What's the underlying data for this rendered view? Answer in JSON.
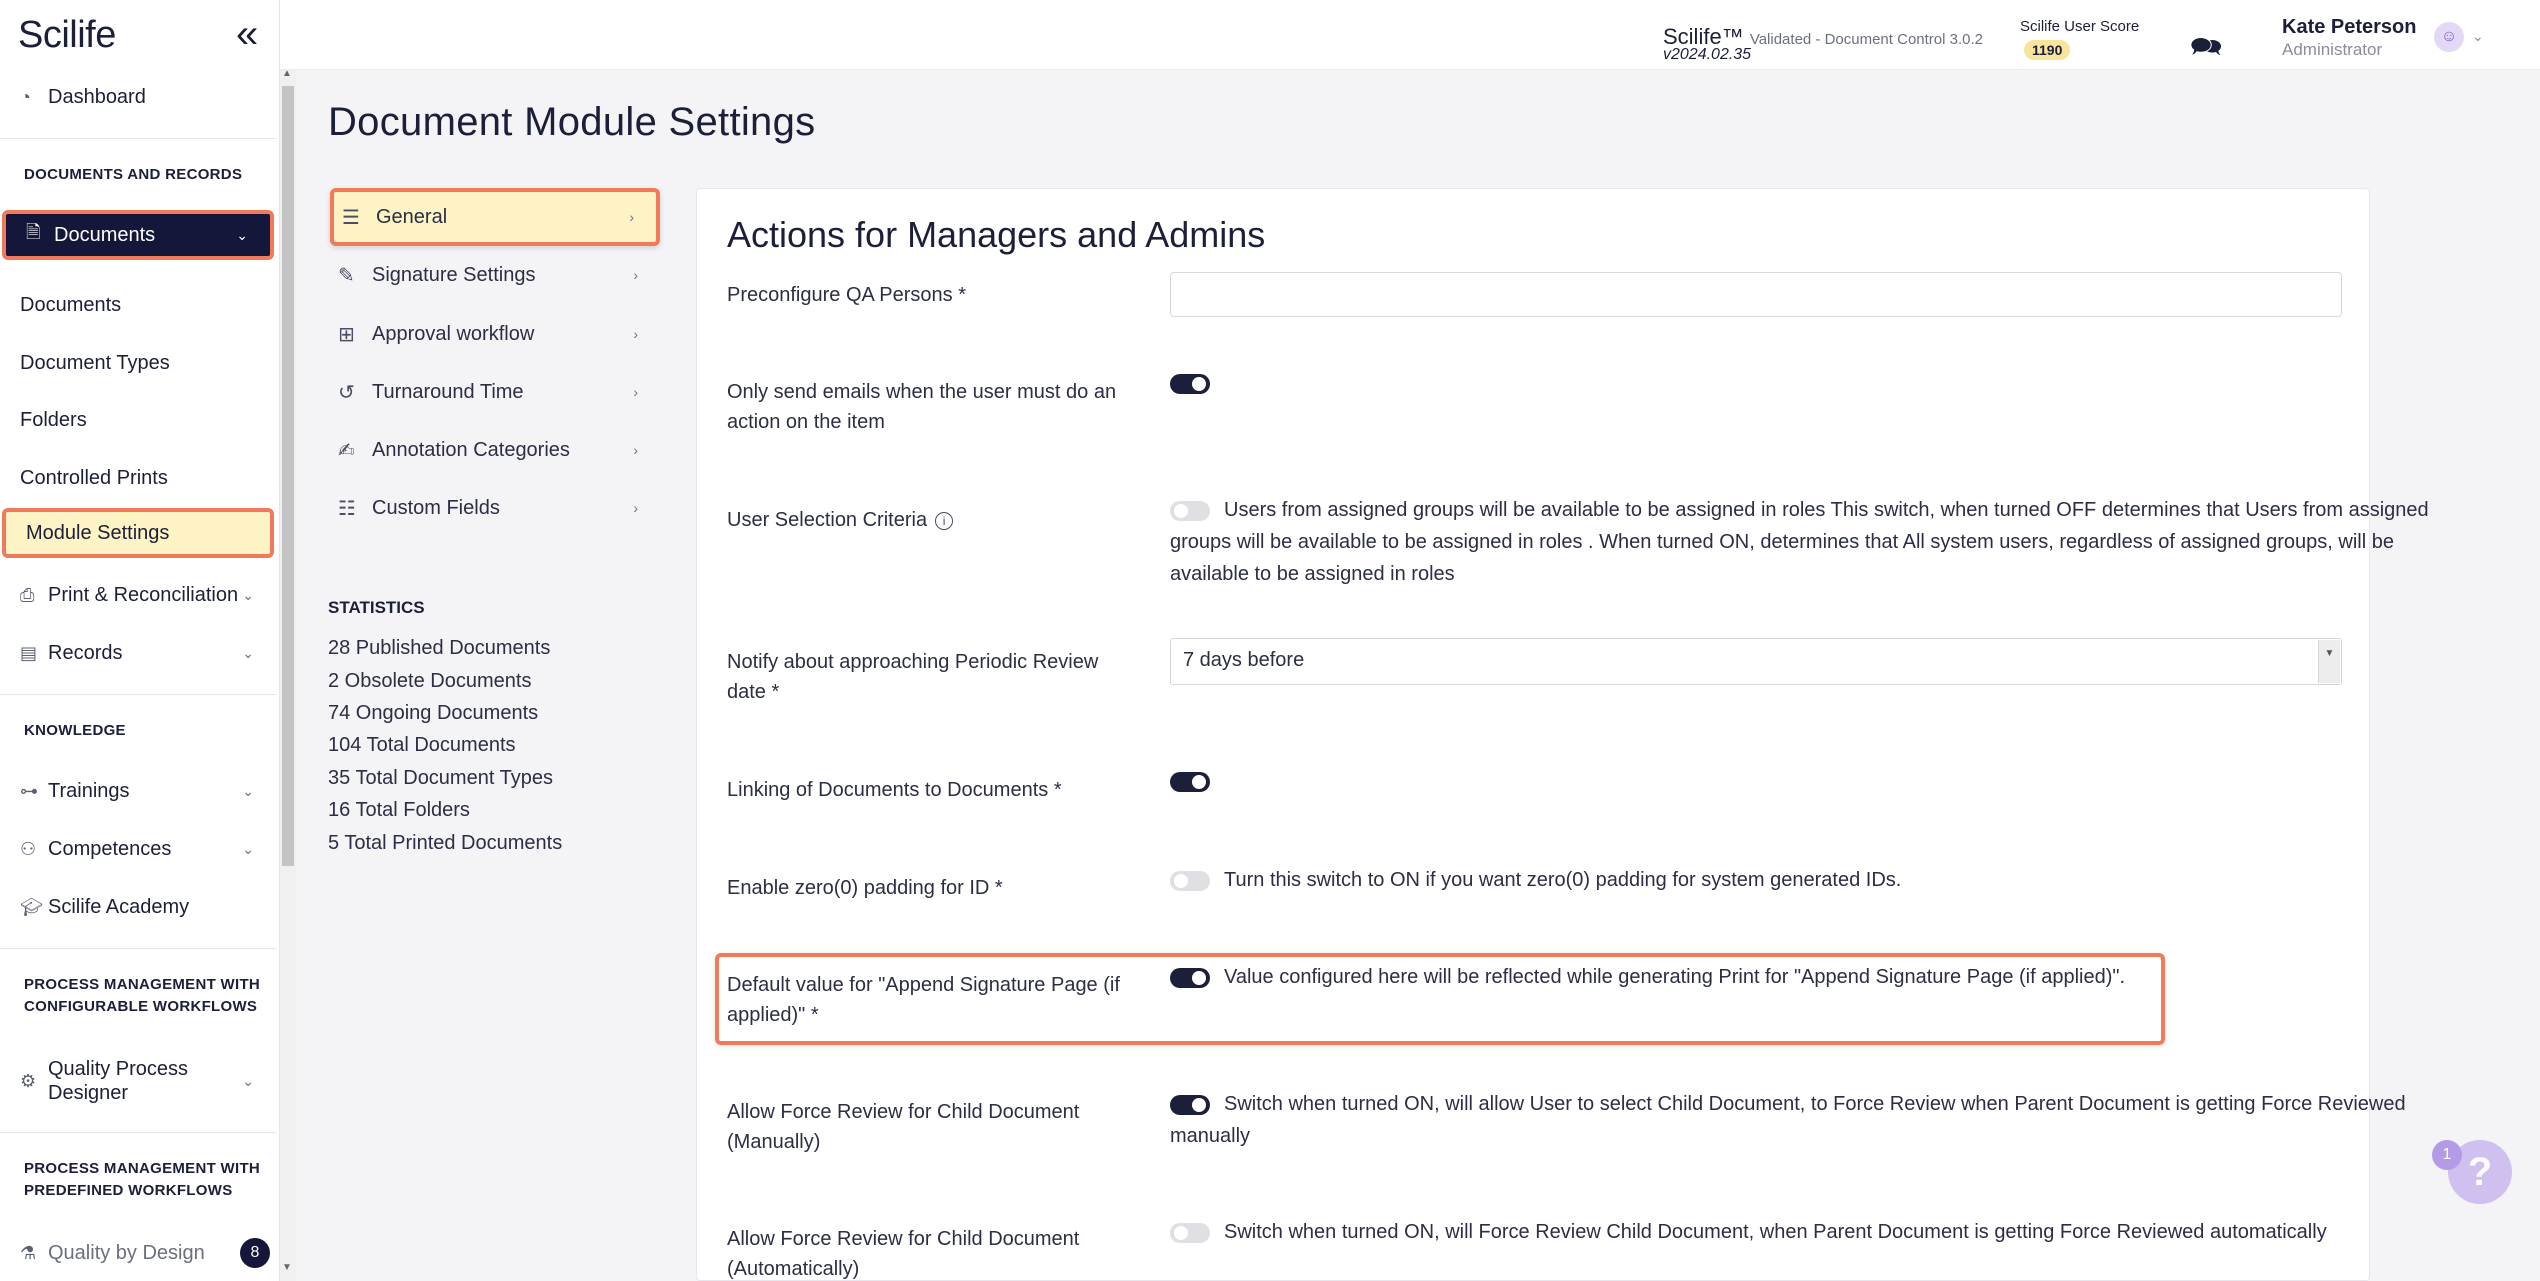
{
  "app": {
    "logo": "Scilife",
    "collapse_icon": "double-chevron-left-icon"
  },
  "topbar": {
    "product": "Scilife™",
    "product_sub": "Validated - Document Control 3.0.2",
    "version": "v2024.02.35",
    "score_label": "Scilife User Score",
    "score_value": "1190",
    "user_name": "Kate Peterson",
    "user_role": "Administrator"
  },
  "sidebar": {
    "dashboard": "Dashboard",
    "section_docs": "DOCUMENTS AND RECORDS",
    "documents_group": "Documents",
    "sub_documents": "Documents",
    "sub_document_types": "Document Types",
    "sub_folders": "Folders",
    "sub_controlled_prints": "Controlled Prints",
    "sub_module_settings": "Module Settings",
    "print_reconciliation": "Print & Reconciliation",
    "records": "Records",
    "section_knowledge": "KNOWLEDGE",
    "trainings": "Trainings",
    "competences": "Competences",
    "academy": "Scilife Academy",
    "section_configurable_1": "PROCESS MANAGEMENT WITH",
    "section_configurable_2": "CONFIGURABLE WORKFLOWS",
    "qpd_1": "Quality Process",
    "qpd_2": "Designer",
    "section_predefined_1": "PROCESS MANAGEMENT WITH",
    "section_predefined_2": "PREDEFINED WORKFLOWS",
    "quality_by_design": "Quality by Design",
    "qbd_badge": "8"
  },
  "page": {
    "title": "Document Module Settings"
  },
  "settings_menu": {
    "general": "General",
    "signature": "Signature Settings",
    "approval": "Approval workflow",
    "turnaround": "Turnaround Time",
    "annotation": "Annotation Categories",
    "custom_fields": "Custom Fields"
  },
  "statistics": {
    "title": "STATISTICS",
    "items": [
      "28  Published Documents",
      "2  Obsolete Documents",
      "74  Ongoing Documents",
      "104  Total Documents",
      "35  Total Document Types",
      "16  Total Folders",
      "5  Total Printed Documents"
    ]
  },
  "panel": {
    "title": "Actions for Managers and Admins",
    "qa_label": "Preconfigure QA Persons *",
    "emails_label_1": "Only send emails when the user must do an",
    "emails_label_2": "action on the item",
    "emails_on": true,
    "usc_label": "User Selection Criteria",
    "usc_on": false,
    "usc_desc": "Users from assigned groups will be available to be assigned in roles This switch, when turned OFF determines that Users from assigned groups will be available to be assigned in roles . When turned ON, determines that All system users, regardless of assigned groups, will be available to be assigned in roles",
    "notify_label_1": "Notify about approaching Periodic Review",
    "notify_label_2": "date *",
    "notify_value": "7 days before",
    "linking_label": "Linking of Documents to Documents *",
    "linking_on": true,
    "zero_label": "Enable zero(0) padding for ID *",
    "zero_on": false,
    "zero_desc": "Turn this switch to ON if you want zero(0) padding for system generated IDs.",
    "append_label_1": "Default value for \"Append Signature Page (if",
    "append_label_2": "applied)\" *",
    "append_on": true,
    "append_desc": "Value configured here will be reflected while generating Print for \"Append Signature Page (if applied)\".",
    "force_manual_label_1": "Allow Force Review for Child Document",
    "force_manual_label_2": "(Manually)",
    "force_manual_on": true,
    "force_manual_desc": "Switch when turned ON, will allow User to select Child Document, to Force Review when Parent Document is getting Force Reviewed manually",
    "force_auto_label_1": "Allow Force Review for Child Document",
    "force_auto_label_2": "(Automatically)",
    "force_auto_on": false,
    "force_auto_desc": "Switch when turned ON, will Force Review Child Document, when Parent Document is getting Force Reviewed automatically"
  },
  "help": {
    "count": "1",
    "icon": "?"
  },
  "colors": {
    "navy": "#14163a",
    "highlight": "#fdf3c4",
    "annotation_border": "#f07a5a",
    "score_badge": "#f8e49a"
  }
}
